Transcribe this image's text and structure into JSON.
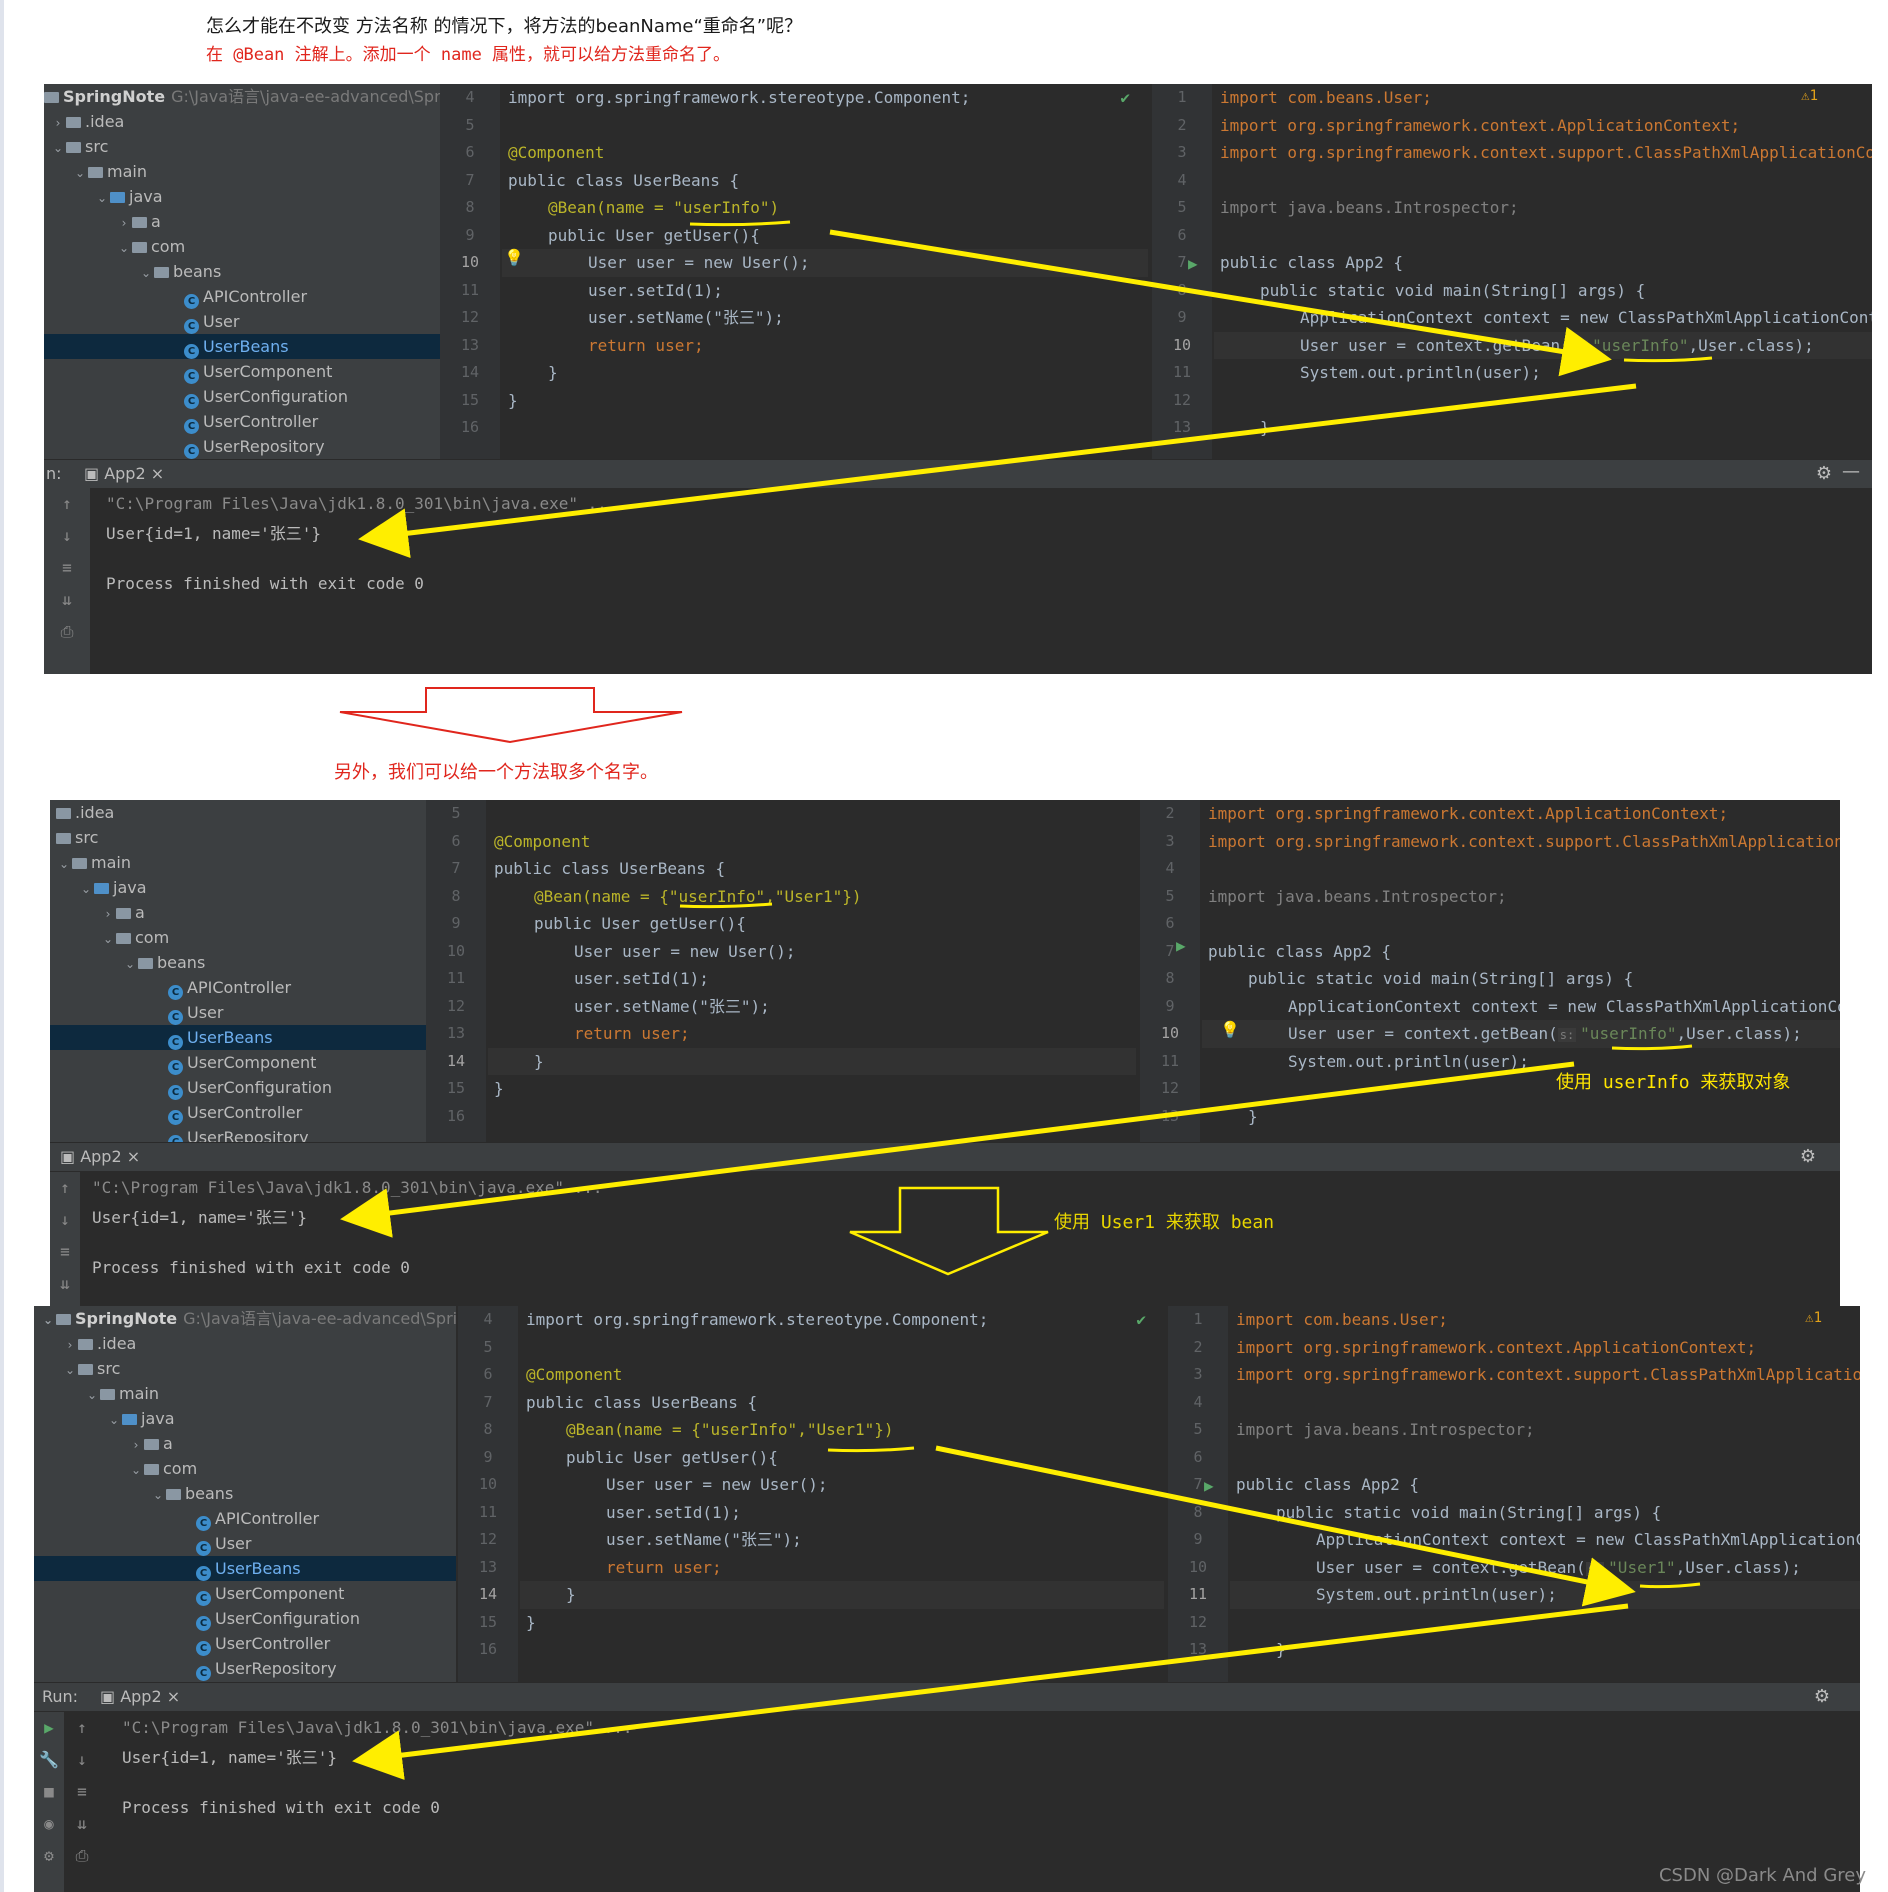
{
  "notes": {
    "line1": "怎么才能在不改变 方法名称 的情况下，将方法的beanName“重命名”呢？",
    "line2": "在 @Bean 注解上。添加一个 name 属性，就可以给方法重命名了。",
    "multi_names": "另外，我们可以给一个方法取多个名字。",
    "use_userinfo": "使用 userInfo 来获取对象",
    "use_user1": "使用 User1 来获取 bean"
  },
  "project": {
    "name": "SpringNote",
    "path": "G:\\Java语言\\java-ee-advanced\\Spring",
    "tree": [
      ".idea",
      "src",
      "main",
      "java",
      "a",
      "com",
      "beans",
      "APIController",
      "User",
      "UserBeans",
      "UserComponent",
      "UserConfiguration",
      "UserController",
      "UserRepository"
    ],
    "selected": "UserBeans"
  },
  "run": {
    "label": "Run:",
    "label_short": "n:",
    "tab": "App2",
    "cmd": "\"C:\\Program Files\\Java\\jdk1.8.0_301\\bin\\java.exe\" ...",
    "output": "User{id=1, name='张三'}",
    "finished": "Process finished with exit code 0"
  },
  "code": {
    "import_component": "import org.springframework.stereotype.Component;",
    "annotation": "@Component",
    "class_decl": "public class UserBeans {",
    "bean_single": "@Bean(name = \"userInfo\")",
    "bean_multi": "@Bean(name = {\"userInfo\",\"User1\"})",
    "method": "public User getUser(){",
    "new_user": "User user = new User();",
    "set_id": "user.setId(1);",
    "set_name": "user.setName(\"张三\");",
    "ret": "return user;",
    "close": "}"
  },
  "app2": {
    "imp_user": "import com.beans.User;",
    "imp_ctx": "import org.springframework.context.ApplicationContext;",
    "imp_cpx": "import org.springframework.context.support.ClassPathXmlApplicationContext;",
    "imp_intro": "import java.beans.Introspector;",
    "class_decl": "public class App2 {",
    "main": "public static void main(String[] args) {",
    "ctx": "ApplicationContext context = new ClassPathXmlApplicationContext(",
    "getbean_prefix": "User user = context.getBean(",
    "getbean_hint": "s:",
    "name_userinfo": "\"userInfo\"",
    "name_user1": "\"User1\"",
    "getbean_suffix": ",User.class);",
    "println": "System.out.println(user);",
    "warning_count": "1"
  },
  "watermark": "CSDN @Dark And Grey",
  "colors": {
    "arrow_yellow": "#ffee00",
    "red_note": "#e0261d",
    "ide_bg": "#2b2b2b",
    "selection": "#0d293e"
  }
}
